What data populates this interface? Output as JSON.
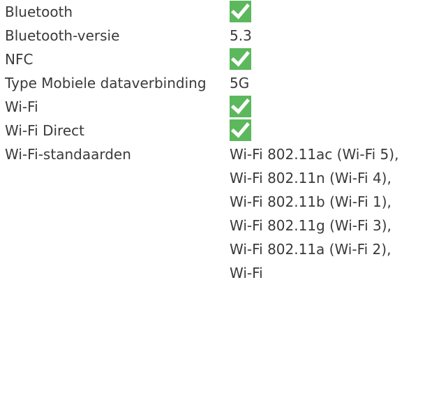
{
  "colors": {
    "text": "#3a3a3a",
    "check_background": "#5cb85c",
    "check_mark": "#ffffff"
  },
  "specs": [
    {
      "label": "Bluetooth",
      "value": null,
      "icon": "checkmark-icon"
    },
    {
      "label": "Bluetooth-versie",
      "value": "5.3"
    },
    {
      "label": "NFC",
      "value": null,
      "icon": "checkmark-icon"
    },
    {
      "label": "Type Mobiele dataverbinding",
      "value": "5G"
    },
    {
      "label": "Wi-Fi",
      "value": null,
      "icon": "checkmark-icon"
    },
    {
      "label": "Wi-Fi Direct",
      "value": null,
      "icon": "checkmark-icon"
    },
    {
      "label": "Wi-Fi-standaarden",
      "value": "Wi-Fi 802.11ac (Wi-Fi 5), Wi-Fi 802.11n (Wi-Fi 4), Wi-Fi 802.11b (Wi-Fi 1), Wi-Fi 802.11g (Wi-Fi 3), Wi-Fi 802.11a (Wi-Fi 2), Wi-Fi"
    }
  ]
}
